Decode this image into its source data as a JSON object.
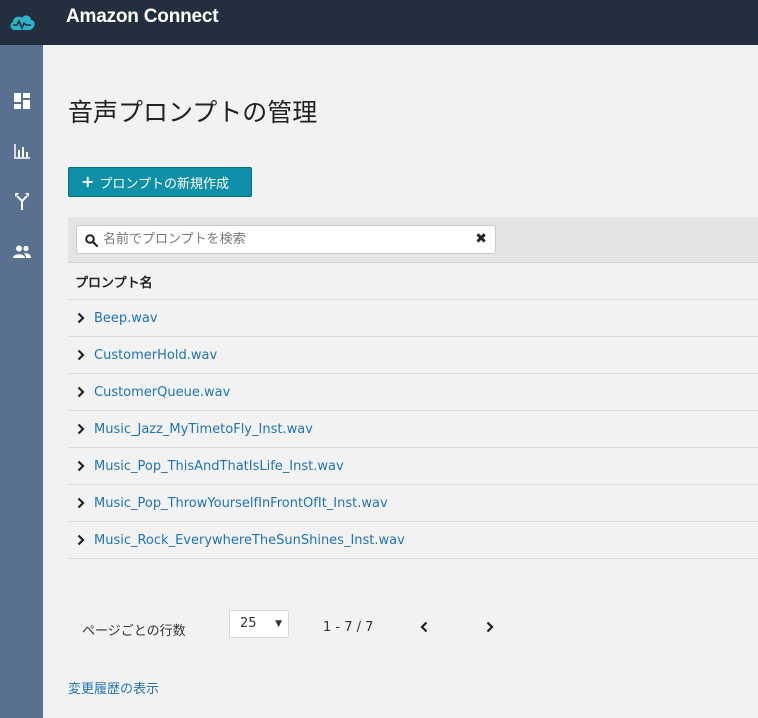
{
  "header": {
    "app_title": "Amazon Connect",
    "logo_icon": "amazon-connect-cloud-icon"
  },
  "sidebar": {
    "items": [
      {
        "icon": "dashboard-icon"
      },
      {
        "icon": "metrics-chart-icon"
      },
      {
        "icon": "routing-icon"
      },
      {
        "icon": "users-icon"
      }
    ]
  },
  "main": {
    "title": "音声プロンプトの管理",
    "create_button": "プロンプトの新規作成",
    "search": {
      "placeholder": "名前でプロンプトを検索",
      "value": ""
    },
    "table": {
      "column_header": "プロンプト名",
      "rows": [
        "Beep.wav",
        "CustomerHold.wav",
        "CustomerQueue.wav",
        "Music_Jazz_MyTimetoFly_Inst.wav",
        "Music_Pop_ThisAndThatIsLife_Inst.wav",
        "Music_Pop_ThrowYourselfInFrontOfIt_Inst.wav",
        "Music_Rock_EverywhereTheSunShines_Inst.wav"
      ]
    },
    "pagination": {
      "rows_per_page_label": "ページごとの行数",
      "rows_per_page_value": "25",
      "range": "1 - 7 / 7"
    },
    "history_link": "変更履歴の表示"
  },
  "colors": {
    "header_bg": "#232f3e",
    "sidebar_bg": "#5a7090",
    "accent_button": "#0f8fa8",
    "link": "#1f73b7"
  }
}
